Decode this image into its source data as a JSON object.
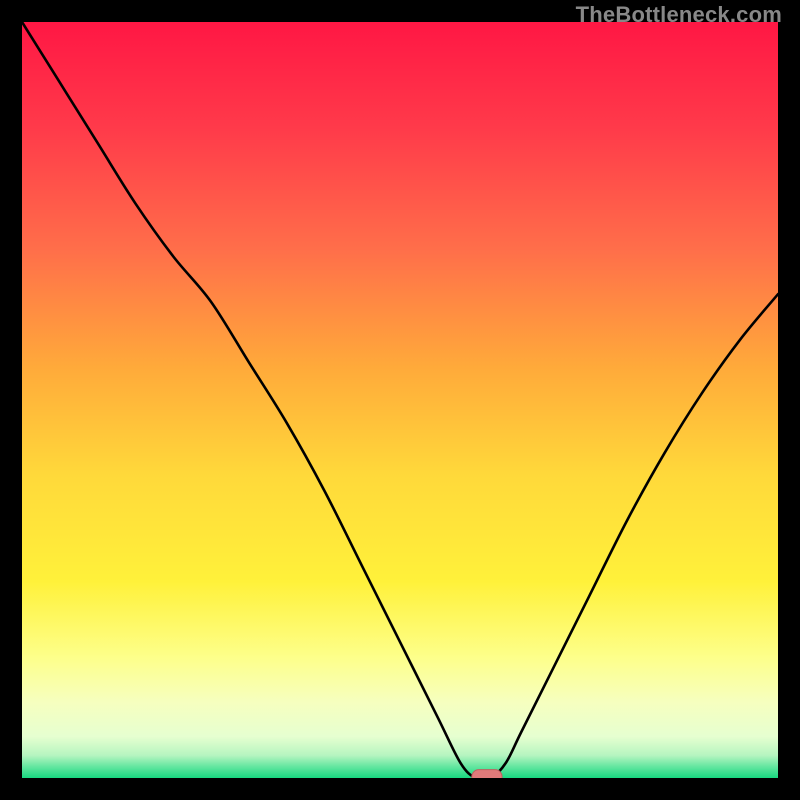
{
  "watermark": "TheBottleneck.com",
  "colors": {
    "black": "#000000",
    "curve": "#000000",
    "marker_fill": "#e07a7a",
    "marker_stroke": "#c06060"
  },
  "chart_data": {
    "type": "line",
    "title": "",
    "xlabel": "",
    "ylabel": "",
    "xlim": [
      0,
      100
    ],
    "ylim": [
      0,
      100
    ],
    "annotations": [],
    "background": {
      "type": "vertical-gradient",
      "stops": [
        {
          "pos": 0.0,
          "color": "#ff1744"
        },
        {
          "pos": 0.14,
          "color": "#ff3a4a"
        },
        {
          "pos": 0.3,
          "color": "#ff6e4a"
        },
        {
          "pos": 0.46,
          "color": "#ffab3a"
        },
        {
          "pos": 0.6,
          "color": "#ffd93a"
        },
        {
          "pos": 0.74,
          "color": "#fff13a"
        },
        {
          "pos": 0.84,
          "color": "#fdff8a"
        },
        {
          "pos": 0.9,
          "color": "#f6ffbf"
        },
        {
          "pos": 0.945,
          "color": "#e6ffd0"
        },
        {
          "pos": 0.97,
          "color": "#b6f5c0"
        },
        {
          "pos": 0.985,
          "color": "#63e6a0"
        },
        {
          "pos": 1.0,
          "color": "#18d880"
        }
      ]
    },
    "series": [
      {
        "name": "bottleneck-curve",
        "x": [
          0,
          5,
          10,
          15,
          20,
          25,
          30,
          35,
          40,
          45,
          50,
          55,
          58,
          60,
          62,
          64,
          66,
          70,
          75,
          80,
          85,
          90,
          95,
          100
        ],
        "y": [
          100,
          92,
          84,
          76,
          69,
          63,
          55,
          47,
          38,
          28,
          18,
          8,
          2,
          0,
          0,
          2,
          6,
          14,
          24,
          34,
          43,
          51,
          58,
          64
        ]
      }
    ],
    "marker": {
      "x": 61.5,
      "y": 0,
      "shape": "rounded-rect",
      "width": 4.0,
      "height": 2.2
    }
  }
}
